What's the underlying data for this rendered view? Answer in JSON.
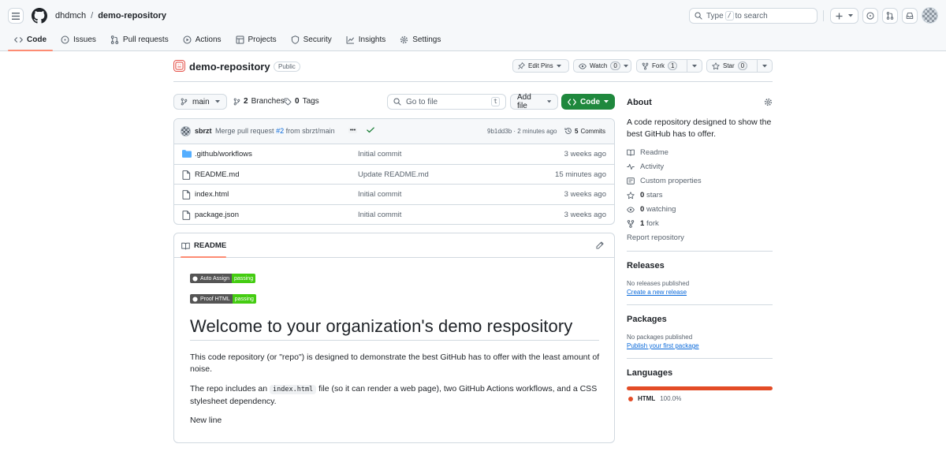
{
  "header": {
    "owner": "dhdmch",
    "separator": "/",
    "repo": "demo-repository",
    "search_prefix": "Type",
    "search_key": "/",
    "search_suffix": "to search"
  },
  "tabs": [
    {
      "label": "Code",
      "icon": "code-icon"
    },
    {
      "label": "Issues",
      "icon": "issue-icon"
    },
    {
      "label": "Pull requests",
      "icon": "pull-request-icon"
    },
    {
      "label": "Actions",
      "icon": "play-icon"
    },
    {
      "label": "Projects",
      "icon": "table-icon"
    },
    {
      "label": "Security",
      "icon": "shield-icon"
    },
    {
      "label": "Insights",
      "icon": "graph-icon"
    },
    {
      "label": "Settings",
      "icon": "gear-icon"
    }
  ],
  "repo_header": {
    "name": "demo-repository",
    "visibility": "Public",
    "edit_pins": "Edit Pins",
    "watch": "Watch",
    "watch_count": "0",
    "fork": "Fork",
    "fork_count": "1",
    "star": "Star",
    "star_count": "0"
  },
  "toolbar": {
    "branch": "main",
    "branches_count": "2",
    "branches_label": "Branches",
    "tags_count": "0",
    "tags_label": "Tags",
    "goto_placeholder": "Go to file",
    "goto_key": "t",
    "add_file": "Add file",
    "code": "Code"
  },
  "latest_commit": {
    "author": "sbrzt",
    "message_prefix": "Merge pull request",
    "pr": "#2",
    "message_suffix": "from sbrzt/main",
    "sha_time": "9b1dd3b · 2 minutes ago",
    "commits_count": "5",
    "commits_label": "Commits"
  },
  "files": [
    {
      "name": ".github/workflows",
      "type": "folder",
      "message": "Initial commit",
      "age": "3 weeks ago"
    },
    {
      "name": "README.md",
      "type": "file",
      "message": "Update README.md",
      "age": "15 minutes ago"
    },
    {
      "name": "index.html",
      "type": "file",
      "message": "Initial commit",
      "age": "3 weeks ago"
    },
    {
      "name": "package.json",
      "type": "file",
      "message": "Initial commit",
      "age": "3 weeks ago"
    }
  ],
  "readme": {
    "tab": "README",
    "badges": [
      {
        "label": "Auto Assign",
        "status": "passing"
      },
      {
        "label": "Proof HTML",
        "status": "passing"
      }
    ],
    "heading": "Welcome to your organization's demo respository",
    "p1": "This code repository (or \"repo\") is designed to demonstrate the best GitHub has to offer with the least amount of noise.",
    "p2_before": "The repo includes an",
    "p2_code": "index.html",
    "p2_after": "file (so it can render a web page), two GitHub Actions workflows, and a CSS stylesheet dependency.",
    "p3": "New line"
  },
  "sidebar": {
    "about_title": "About",
    "description": "A code repository designed to show the best GitHub has to offer.",
    "readme": "Readme",
    "activity": "Activity",
    "custom_properties": "Custom properties",
    "stars_count": "0",
    "stars_label": "stars",
    "watching_count": "0",
    "watching_label": "watching",
    "forks_count": "1",
    "forks_label": "fork",
    "report": "Report repository",
    "releases_title": "Releases",
    "no_releases": "No releases published",
    "create_release": "Create a new release",
    "packages_title": "Packages",
    "no_packages": "No packages published",
    "publish_package": "Publish your first package",
    "languages_title": "Languages",
    "language": "HTML",
    "language_pct": "100.0%",
    "language_color": "#e34c26"
  },
  "colors": {
    "accent_tab": "#fd8c73",
    "primary_button": "#1f883d",
    "link": "#0969da"
  }
}
